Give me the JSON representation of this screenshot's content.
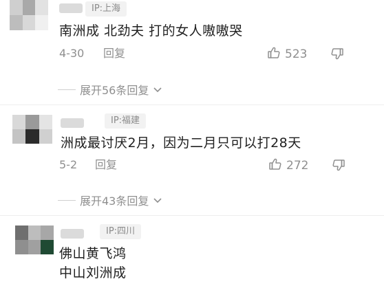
{
  "comments": [
    {
      "ip": "IP:上海",
      "text": "南洲成  北劲夫  打的女人嗷嗷哭",
      "date": "4-30",
      "reply_label": "回复",
      "likes": "523",
      "expand_label": "展开56条回复"
    },
    {
      "ip": "IP:福建",
      "text": "洲成最讨厌2月，因为二月只可以打28天",
      "date": "5-2",
      "reply_label": "回复",
      "likes": "272",
      "expand_label": "展开43条回复"
    },
    {
      "ip": "IP:四川",
      "text_line1": "佛山黄飞鸿",
      "text_line2": "中山刘洲成"
    }
  ],
  "colors": {
    "muted_text": "#8f8f8f",
    "badge_bg": "#f2f2f2",
    "body_text": "#202020"
  }
}
